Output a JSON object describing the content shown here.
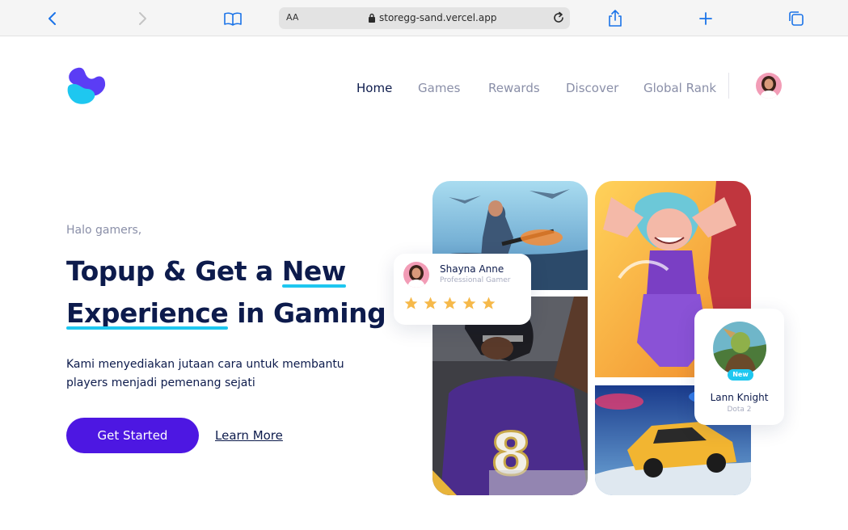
{
  "browser": {
    "text_size_label": "AA",
    "url": "storegg-sand.vercel.app"
  },
  "nav": {
    "items": [
      {
        "label": "Home",
        "active": true
      },
      {
        "label": "Games",
        "active": false
      },
      {
        "label": "Rewards",
        "active": false
      },
      {
        "label": "Discover",
        "active": false
      },
      {
        "label": "Global Rank",
        "active": false
      }
    ]
  },
  "hero": {
    "greeting": "Halo gamers,",
    "headline_part1": "Topup & Get a",
    "headline_highlight1": "New",
    "headline_highlight2": "Experience",
    "headline_part2": "in Gaming",
    "description_line1": "Kami menyediakan jutaan cara untuk membantu",
    "description_line2": "players menjadi pemenang sejati",
    "primary_button": "Get Started",
    "secondary_link": "Learn More"
  },
  "rating_card": {
    "name": "Shayna Anne",
    "role": "Professional Gamer",
    "stars": 5
  },
  "player_card": {
    "badge": "New",
    "name": "Lann Knight",
    "game": "Dota 2"
  },
  "colors": {
    "primary": "#4d17e2",
    "accent": "#1ec7f0",
    "text_dark": "#0d1b4c",
    "text_muted": "#8a8fa8",
    "star": "#f6b94a"
  }
}
